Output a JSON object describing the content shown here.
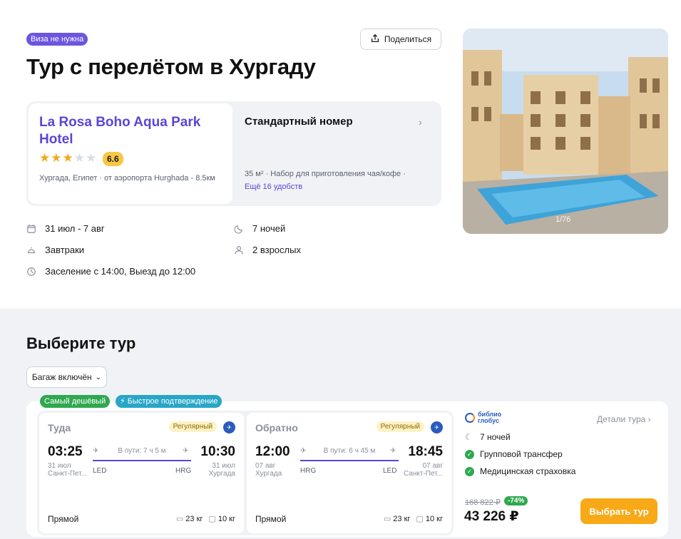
{
  "header": {
    "visa_badge": "Виза не нужна",
    "share_label": "Поделиться",
    "title": "Тур с перелётом в Хургаду"
  },
  "hotel": {
    "name": "La Rosa Boho Aqua Park Hotel",
    "stars": 3,
    "stars_max": 5,
    "rating": "6.6",
    "location": "Хургада, Египет · от аэропорта Hurghada - 8.5км"
  },
  "room": {
    "title": "Стандартный номер",
    "meta": "35 м² · Набор для приготовления чая/кофе ·",
    "more_link": "Ещё 16 удобств"
  },
  "facts": {
    "dates": "31 июл - 7 авг",
    "nights": "7 ночей",
    "meal": "Завтраки",
    "guests": "2 взрослых",
    "checkin": "Заселение с 14:00, Выезд до 12:00"
  },
  "photo": {
    "counter": "1/76"
  },
  "choose": {
    "title": "Выберите тур",
    "filter_label": "Багаж включён"
  },
  "tags": {
    "cheapest": "Самый дешёвый",
    "fast": "⚡ Быстрое подтверждение"
  },
  "outbound": {
    "title": "Туда",
    "type": "Регулярный",
    "dep_time": "03:25",
    "arr_time": "10:30",
    "duration": "В пути: 7 ч 5 м",
    "dep_date": "31 июл",
    "dep_city": "Санкт-Пет...",
    "arr_date": "31 июл",
    "arr_city": "Хургада",
    "dep_code": "LED",
    "arr_code": "HRG",
    "direct": "Прямой",
    "bag1": "23 кг",
    "bag2": "10 кг"
  },
  "inbound": {
    "title": "Обратно",
    "type": "Регулярный",
    "dep_time": "12:00",
    "arr_time": "18:45",
    "duration": "В пути: 6 ч 45 м",
    "dep_date": "07 авг",
    "dep_city": "Хургада",
    "arr_date": "07 авг",
    "arr_city": "Санкт-Пет...",
    "dep_code": "HRG",
    "arr_code": "LED",
    "direct": "Прямой",
    "bag1": "23 кг",
    "bag2": "10 кг"
  },
  "offer": {
    "operator_line1": "библио",
    "operator_line2": "глобус",
    "details_link": "Детали тура",
    "nights": "7 ночей",
    "feature1": "Групповой трансфер",
    "feature2": "Медицинская страховка",
    "old_price": "168 822 ₽",
    "discount": "-74%",
    "price": "43 226 ₽",
    "buy_label": "Выбрать тур"
  },
  "colors": {
    "accent": "#5a46d6",
    "cta": "#f7a917",
    "success": "#2fa84f"
  }
}
